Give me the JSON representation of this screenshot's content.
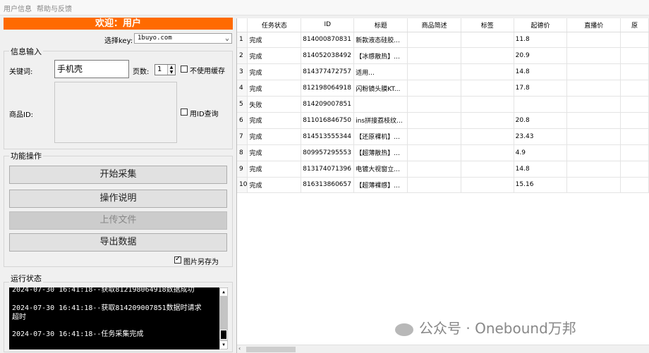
{
  "menu": {
    "items": [
      "用户信息",
      "帮助与反馈"
    ]
  },
  "left": {
    "welcome": "欢迎：用户",
    "select_key_label": "选择key:",
    "select_key_value": "1buyo.com",
    "info_group_title": "信息输入",
    "keyword_label": "关键词:",
    "keyword_value": "手机壳",
    "pages_label": "页数:",
    "pages_value": "1",
    "no_cache_label": "不使用缓存",
    "product_id_label": "商品ID:",
    "id_query_label": "用ID查询",
    "func_group_title": "功能操作",
    "btn_start": "开始采集",
    "btn_help": "操作说明",
    "btn_upload": "上传文件",
    "btn_export": "导出数据",
    "save_images_label": "图片另存为",
    "status_group_title": "运行状态",
    "console_lines": [
      "2024-07-30 16:41:18--获取812198064918数据成功",
      "2024-07-30 16:41:18--获取814209007851数据时请求",
      "超时",
      "2024-07-30 16:41:18--任务采集完成"
    ]
  },
  "table": {
    "columns": [
      "",
      "任务状态",
      "ID",
      "标题",
      "商品简述",
      "标签",
      "起德价",
      "直播价",
      "原"
    ],
    "rows": [
      [
        "1",
        "完成",
        "814000870831",
        "新款液态硅胶...",
        "",
        "",
        "11.8",
        "",
        ""
      ],
      [
        "2",
        "完成",
        "814052038492",
        "【冰感散热】...",
        "",
        "",
        "20.9",
        "",
        ""
      ],
      [
        "3",
        "完成",
        "814377472757",
        "适用...",
        "",
        "",
        "14.8",
        "",
        ""
      ],
      [
        "4",
        "完成",
        "812198064918",
        "闪粉镜头膜KT...",
        "",
        "",
        "17.8",
        "",
        ""
      ],
      [
        "5",
        "失败",
        "814209007851",
        "",
        "",
        "",
        "",
        "",
        ""
      ],
      [
        "6",
        "完成",
        "811016846750",
        "ins拼接荔枝纹...",
        "",
        "",
        "20.8",
        "",
        ""
      ],
      [
        "7",
        "完成",
        "814513555344",
        "【还原裸机】...",
        "",
        "",
        "23.43",
        "",
        ""
      ],
      [
        "8",
        "完成",
        "809957295553",
        "【超薄散热】...",
        "",
        "",
        "4.9",
        "",
        ""
      ],
      [
        "9",
        "完成",
        "813174071396",
        "电镀大视窗立...",
        "",
        "",
        "14.8",
        "",
        ""
      ],
      [
        "10",
        "完成",
        "816313860657",
        "【超薄裸感】...",
        "",
        "",
        "15.16",
        "",
        ""
      ]
    ]
  },
  "watermark": "公众号 · Onebound万邦"
}
